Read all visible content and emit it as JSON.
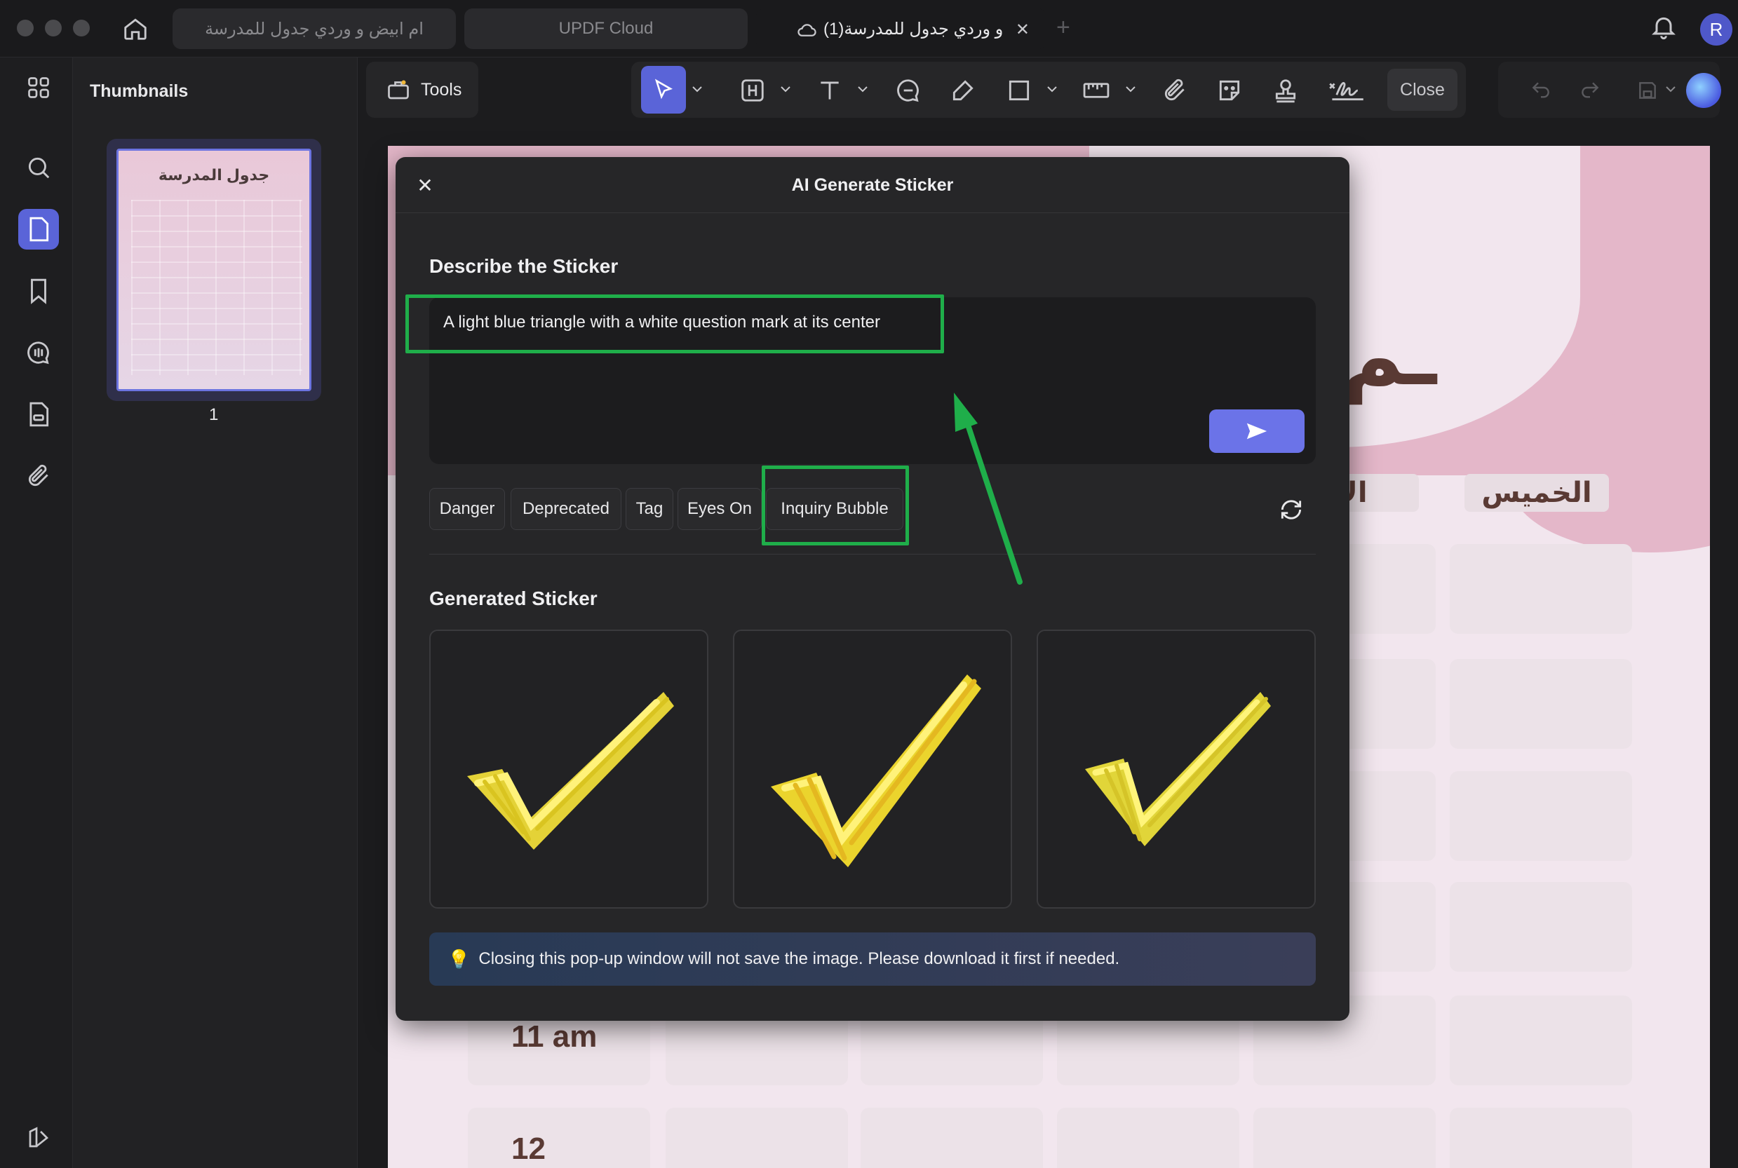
{
  "tabs": [
    {
      "label": "ام ابيض و وردي جدول للمدرسة"
    },
    {
      "label": "UPDF Cloud"
    },
    {
      "label": "و وردي جدول للمدرسة(1)"
    }
  ],
  "user": {
    "initial": "R"
  },
  "thumbnails": {
    "title": "Thumbnails",
    "page_title": "جدول المدرسة",
    "page_number": "1"
  },
  "toolbar": {
    "tools_label": "Tools",
    "close_label": "Close"
  },
  "document": {
    "days": [
      "الخميس",
      "الار"
    ],
    "times": [
      "11 am",
      "12"
    ]
  },
  "dialog": {
    "title": "AI Generate Sticker",
    "describe_label": "Describe the Sticker",
    "prompt_value": "A light blue triangle with a white question mark at its center",
    "suggestions": [
      "Danger",
      "Deprecated",
      "Tag",
      "Eyes On",
      "Inquiry Bubble"
    ],
    "generated_label": "Generated Sticker",
    "notice": "Closing this pop-up window will not save the image. Please download it first if needed."
  },
  "colors": {
    "accent": "#5a64d8",
    "highlight": "#1fae4a",
    "sticker_yellow": "#f5e23a"
  }
}
